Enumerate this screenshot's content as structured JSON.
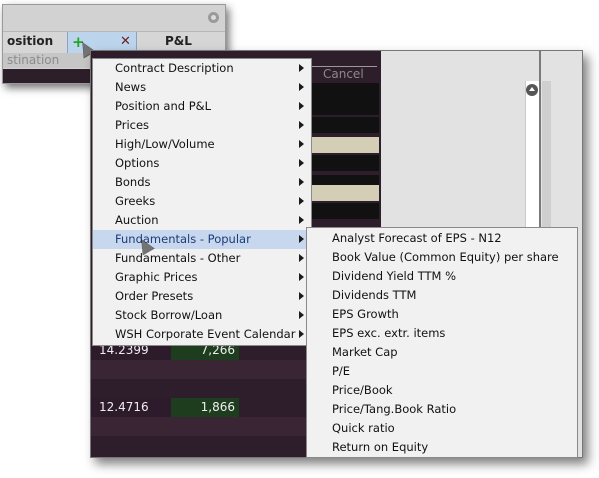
{
  "header": {
    "position_col": "osition",
    "pnl_col": "P&L",
    "destination_label": "stination"
  },
  "toolbar": {
    "cancel_label": "Cancel"
  },
  "main_menu": {
    "items": [
      {
        "label": "Contract Description",
        "has_submenu": true
      },
      {
        "label": "News",
        "has_submenu": true
      },
      {
        "label": "Position and P&L",
        "has_submenu": true
      },
      {
        "label": "Prices",
        "has_submenu": true
      },
      {
        "label": "High/Low/Volume",
        "has_submenu": true
      },
      {
        "label": "Options",
        "has_submenu": true
      },
      {
        "label": "Bonds",
        "has_submenu": true
      },
      {
        "label": "Greeks",
        "has_submenu": true
      },
      {
        "label": "Auction",
        "has_submenu": true
      },
      {
        "label": "Fundamentals - Popular",
        "has_submenu": true,
        "highlighted": true
      },
      {
        "label": "Fundamentals - Other",
        "has_submenu": true
      },
      {
        "label": "Graphic Prices",
        "has_submenu": true
      },
      {
        "label": "Order Presets",
        "has_submenu": true
      },
      {
        "label": "Stock Borrow/Loan",
        "has_submenu": true
      },
      {
        "label": "WSH Corporate Event Calendar",
        "has_submenu": true
      }
    ]
  },
  "sub_menu": {
    "items": [
      "Analyst Forecast of EPS - N12",
      "Book Value (Common Equity) per share",
      "Dividend Yield TTM %",
      "Dividends TTM",
      "EPS Growth",
      "EPS exc. extr. items",
      "Market Cap",
      "P/E",
      "Price/Book",
      "Price/Tang.Book Ratio",
      "Quick ratio",
      "Return on Equity"
    ]
  },
  "grid": {
    "rows": [
      {
        "price": "14.2399",
        "qty": "7,266"
      },
      {
        "price": "12.4716",
        "qty": "1,866"
      }
    ]
  },
  "colors": {
    "menu_bg": "#f1f1f1",
    "menu_highlight": "#c6d7ee",
    "grid_dark": "#2e1d2b",
    "grid_green": "#1e3c1e",
    "header_bg": "#d6d6d6",
    "tools_bg": "#bcd4ec"
  }
}
